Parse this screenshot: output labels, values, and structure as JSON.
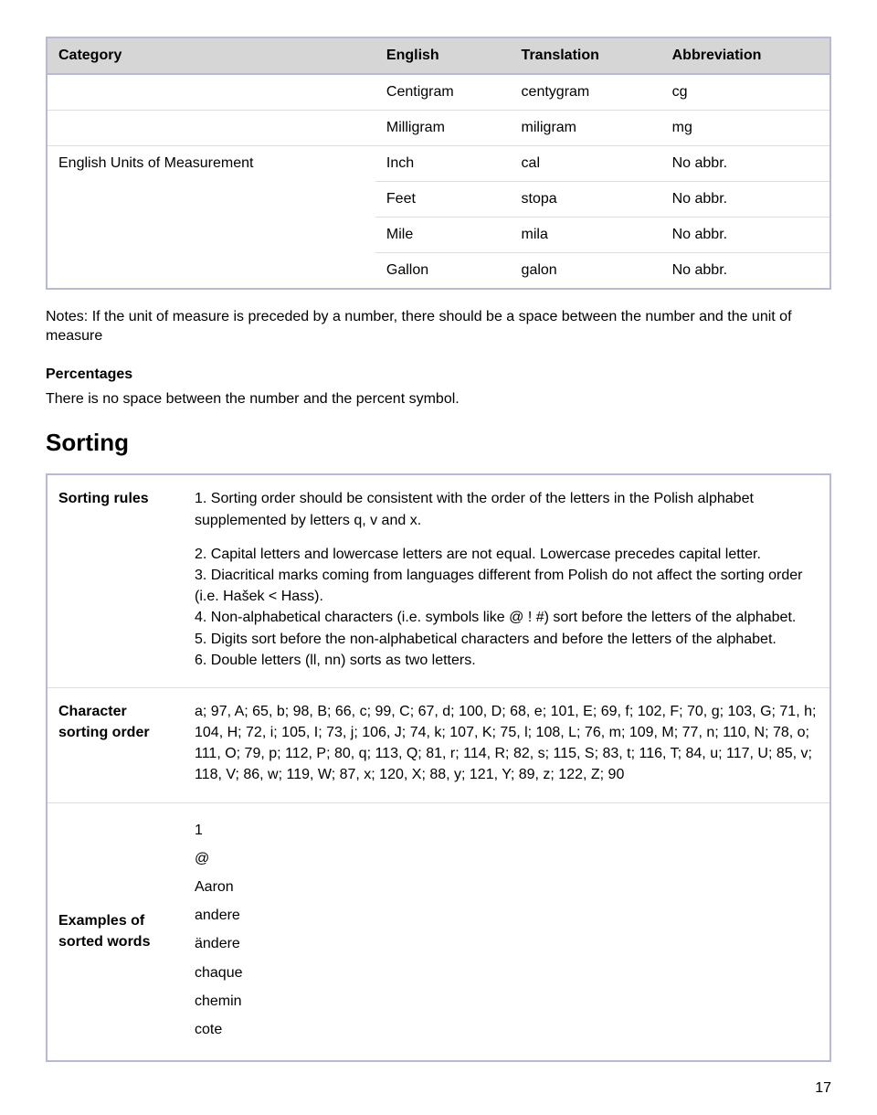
{
  "table1": {
    "headers": [
      "Category",
      "English",
      "Translation",
      "Abbreviation"
    ],
    "rows": [
      {
        "category": "",
        "english": "Centigram",
        "translation": "centygram",
        "abbr": "cg"
      },
      {
        "category": "",
        "english": "Milligram",
        "translation": "miligram",
        "abbr": "mg"
      },
      {
        "category": "English Units of Measurement",
        "english": "Inch",
        "translation": "cal",
        "abbr": "No abbr."
      },
      {
        "category": "",
        "english": "Feet",
        "translation": "stopa",
        "abbr": "No abbr."
      },
      {
        "category": "",
        "english": "Mile",
        "translation": "mila",
        "abbr": "No abbr."
      },
      {
        "category": "",
        "english": "Gallon",
        "translation": "galon",
        "abbr": "No abbr."
      }
    ]
  },
  "notes_text": "Notes: If the unit of measure is preceded by a number, there should be a space between the number and the unit of measure",
  "percentages_head": "Percentages",
  "percentages_text": "There is no space between the number and the percent symbol.",
  "sorting_head": "Sorting",
  "sorting_rules_label": "Sorting rules",
  "sorting_rules_1": "1. Sorting order should be consistent with the order of the letters in the Polish alphabet supplemented by letters q, v and x.",
  "sorting_rules_2": "2. Capital letters and lowercase letters are not equal. Lowercase precedes capital letter.",
  "sorting_rules_3": "3. Diacritical marks coming from languages different from Polish do not affect the sorting order (i.e. Hašek < Hass).",
  "sorting_rules_4": "4. Non-alphabetical characters (i.e. symbols like @ ! #) sort before the letters of the alphabet.",
  "sorting_rules_5": "5. Digits sort before the non-alphabetical characters and before the letters of the alphabet.",
  "sorting_rules_6": "6. Double letters (ll, nn) sorts as two letters.",
  "char_order_label": "Character sorting order",
  "char_order_text": "a; 97, A; 65, b; 98, B; 66, c; 99, C; 67, d; 100, D; 68, e; 101, E; 69, f; 102, F; 70, g; 103, G; 71, h; 104, H; 72, i; 105, I; 73, j; 106, J; 74, k; 107, K; 75, l; 108, L; 76, m; 109, M; 77, n; 110, N; 78, o; 111, O; 79, p; 112, P; 80, q; 113, Q; 81, r; 114, R; 82, s; 115, S; 83, t; 116, T; 84, u; 117, U; 85, v; 118, V; 86, w; 119, W; 87, x; 120, X; 88, y; 121, Y; 89, z; 122, Z; 90",
  "examples_label": "Examples of sorted words",
  "examples_list": [
    "1",
    "@",
    "Aaron",
    "andere",
    "ändere",
    "chaque",
    "chemin",
    "cote"
  ],
  "page_number": "17"
}
